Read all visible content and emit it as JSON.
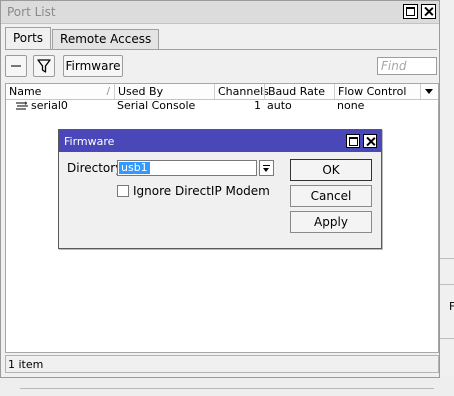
{
  "window": {
    "title": "Port List",
    "tabs": [
      {
        "label": "Ports",
        "active": true
      },
      {
        "label": "Remote Access",
        "active": false
      }
    ],
    "toolbar": {
      "remove_icon": "minus-icon",
      "filter_icon": "filter-icon",
      "firmware_label": "Firmware",
      "find_placeholder": "Find"
    },
    "table": {
      "columns": [
        "Name",
        "Used By",
        "Channels",
        "Baud Rate",
        "Flow Control"
      ],
      "sort_indicator": "/",
      "rows": [
        {
          "name": "serial0",
          "used_by": "Serial Console",
          "channels": "1",
          "baud_rate": "auto",
          "flow_control": "none"
        }
      ]
    },
    "status": "1 item"
  },
  "dialog": {
    "title": "Firmware",
    "directory_label": "Directory:",
    "directory_value": "usb1",
    "ignore_label": "Ignore DirectIP Modem",
    "ignore_checked": false,
    "buttons": {
      "ok": "OK",
      "cancel": "Cancel",
      "apply": "Apply"
    }
  },
  "background": {
    "edge_text": "F"
  },
  "colors": {
    "dialog_title_bar": "#4a48b8",
    "selection": "#3399ff"
  }
}
